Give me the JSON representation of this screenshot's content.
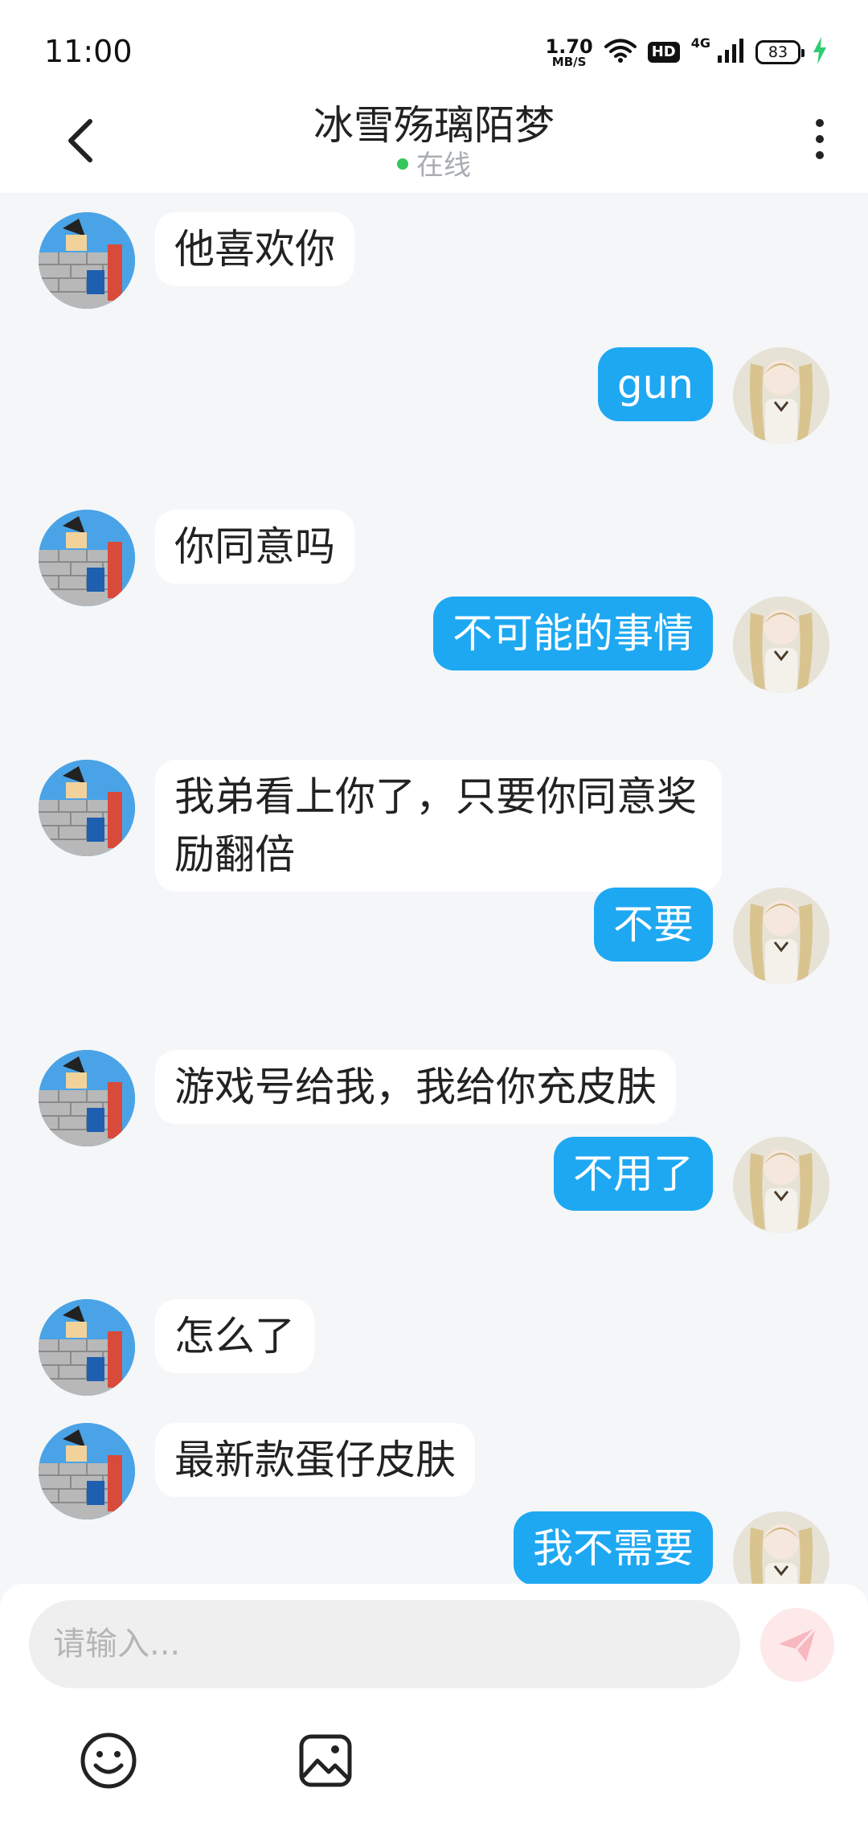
{
  "status_bar": {
    "time": "11:00",
    "net_speed_value": "1.70",
    "net_speed_unit": "MB/S",
    "hd_label": "HD",
    "network_label": "4G",
    "battery_level": "83"
  },
  "header": {
    "title": "冰雪殇璃陌梦",
    "presence": "在线",
    "presence_color": "#34c759"
  },
  "messages": [
    {
      "side": "in",
      "text": "他喜欢你"
    },
    {
      "side": "out",
      "text": "gun"
    },
    {
      "side": "in",
      "text": "你同意吗"
    },
    {
      "side": "out",
      "text": "不可能的事情"
    },
    {
      "side": "in",
      "text": "我弟看上你了，只要你同意奖励翻倍"
    },
    {
      "side": "out",
      "text": "不要"
    },
    {
      "side": "in",
      "text": "游戏号给我，我给你充皮肤"
    },
    {
      "side": "out",
      "text": "不用了"
    },
    {
      "side": "in",
      "text": "怎么了"
    },
    {
      "side": "in",
      "text": "最新款蛋仔皮肤"
    },
    {
      "side": "out",
      "text": "我不需要"
    }
  ],
  "composer": {
    "placeholder": "请输入...",
    "send_icon": "send-icon",
    "emoji_icon": "emoji-icon",
    "image_icon": "image-icon"
  },
  "colors": {
    "outgoing_bubble": "#1ea8f2",
    "incoming_bubble": "#ffffff",
    "background": "#f4f6f8"
  }
}
